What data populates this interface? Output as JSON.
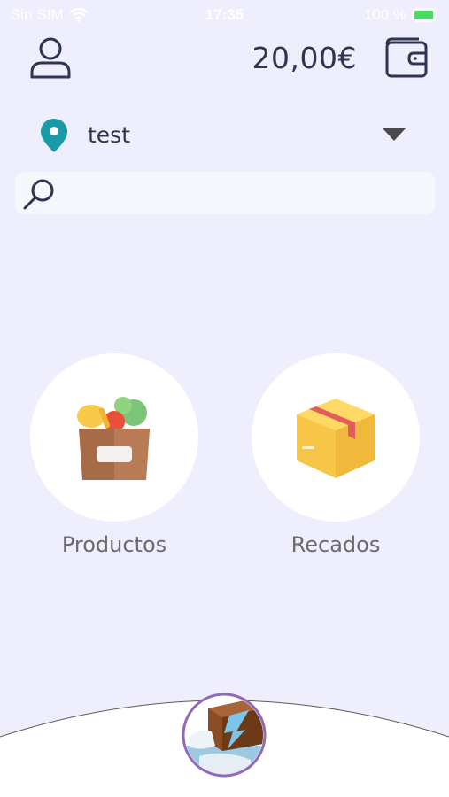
{
  "status_bar": {
    "carrier": "Sin SIM",
    "time": "17:35",
    "battery": "100 %"
  },
  "header": {
    "balance": "20,00€",
    "icons": {
      "profile": "user-icon",
      "wallet": "wallet-icon"
    }
  },
  "location": {
    "selected": "test",
    "icon": "map-pin-icon",
    "accent_color": "#1a9aa6"
  },
  "search": {
    "value": "",
    "placeholder": ""
  },
  "categories": [
    {
      "label": "Productos",
      "icon": "grocery-basket-icon"
    },
    {
      "label": "Recados",
      "icon": "package-box-icon"
    }
  ],
  "bottom_nav": {
    "home_icon": "app-logo-icon"
  },
  "colors": {
    "background": "#efeefc",
    "text_dark": "#2f3550",
    "label_gray": "#6b6b6b"
  }
}
